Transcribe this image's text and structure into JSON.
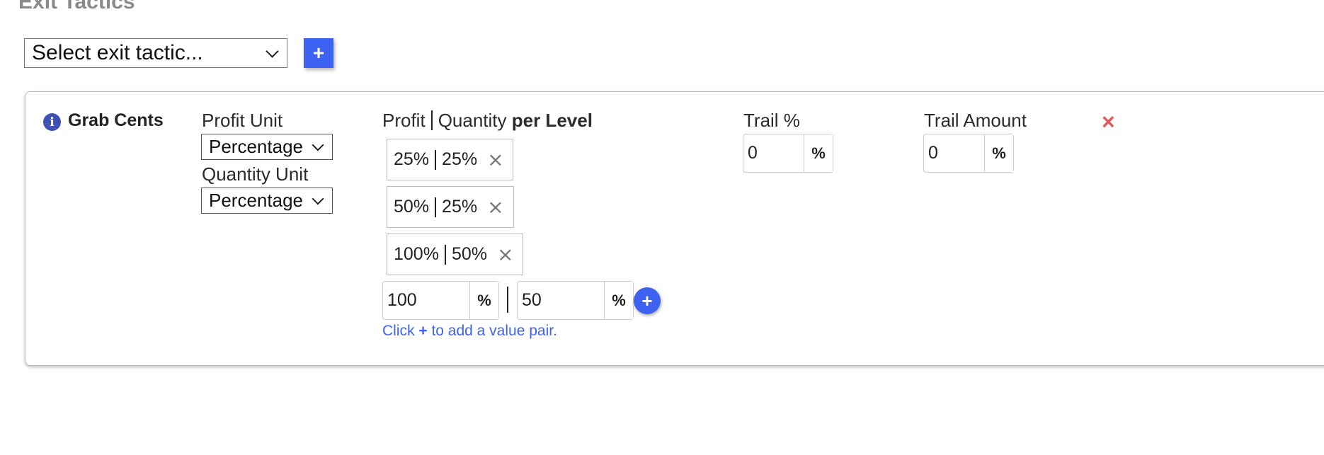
{
  "section": {
    "title": "Exit Tactics"
  },
  "tactic_select": {
    "value": "Select exit tactic...",
    "add_label": "+"
  },
  "tactic": {
    "name": "Grab Cents",
    "info_icon": "info-icon",
    "remove_icon": "close-icon",
    "remove_label": "×",
    "profit_unit": {
      "label": "Profit Unit",
      "value": "Percentage"
    },
    "quantity_unit": {
      "label": "Quantity Unit",
      "value": "Percentage"
    },
    "levels": {
      "header_profit": "Profit",
      "header_quantity": "Quantity",
      "header_suffix": "per Level",
      "pairs": [
        {
          "profit": "25%",
          "quantity": "25%"
        },
        {
          "profit": "50%",
          "quantity": "25%"
        },
        {
          "profit": "100%",
          "quantity": "50%"
        }
      ],
      "remove_glyph": "×",
      "new_profit": "100",
      "new_profit_unit": "%",
      "new_quantity": "50",
      "new_quantity_unit": "%",
      "add_label": "+",
      "hint_prefix": "Click",
      "hint_plus": "+",
      "hint_suffix": "to add a value pair."
    },
    "trail_percent": {
      "label": "Trail %",
      "value": "0",
      "unit": "%"
    },
    "trail_amount": {
      "label": "Trail Amount",
      "value": "0",
      "unit": "%"
    }
  },
  "colors": {
    "accent": "#3e63f2",
    "info": "#3f51b5",
    "remove": "#e05b5b",
    "title": "#8a8a8a"
  }
}
